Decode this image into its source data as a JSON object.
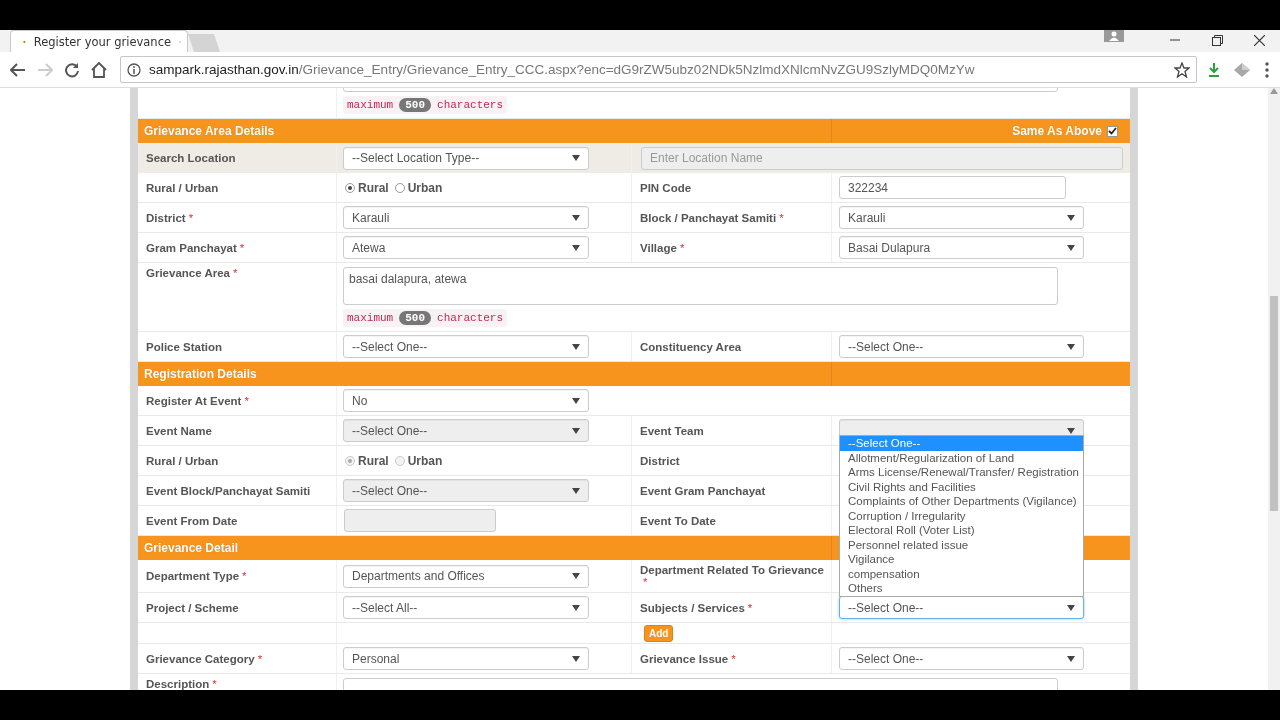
{
  "browser": {
    "tab_title": "Register your grievance",
    "url_domain": "sampark.rajasthan.gov.in",
    "url_path": "/Grievance_Entry/Grievance_Entry_CCC.aspx?enc=dG9rZW5ubz02NDk5NzlmdXNlcmNvZGU9SzlyMDQ0MzYw"
  },
  "form": {
    "lead_row": {
      "shaded": false,
      "cells": [
        {
          "kind": "empty"
        },
        {
          "kind": "textarea",
          "disabled": false,
          "counter": {
            "before": "maximum",
            "count": "500",
            "after": "characters"
          }
        }
      ]
    },
    "sections": [
      {
        "title": "Grievance Area Details",
        "same_as_above": {
          "label": "Same As Above",
          "checked": true
        },
        "rows": [
          {
            "shaded": true,
            "cells": [
              {
                "kind": "label",
                "text": "Search Location"
              },
              {
                "kind": "select",
                "value": "--Select Location Type--",
                "disabled": false,
                "focused": false
              },
              {
                "kind": "location-input",
                "placeholder": "Enter Location Name",
                "disabled": true
              }
            ]
          },
          {
            "shaded": false,
            "cells": [
              {
                "kind": "label",
                "text": "Rural / Urban"
              },
              {
                "kind": "radios",
                "disabled": false,
                "options": [
                  {
                    "text": "Rural",
                    "selected": true
                  },
                  {
                    "text": "Urban",
                    "selected": false
                  }
                ]
              },
              {
                "kind": "label",
                "text": "PIN Code"
              },
              {
                "kind": "input",
                "value": "322234",
                "disabled": false
              }
            ]
          },
          {
            "shaded": false,
            "cells": [
              {
                "kind": "label",
                "text": "District",
                "required": "*"
              },
              {
                "kind": "select",
                "value": "Karauli",
                "disabled": false,
                "focused": false
              },
              {
                "kind": "label",
                "text": "Block / Panchayat Samiti",
                "required": "*"
              },
              {
                "kind": "select",
                "value": "Karauli",
                "disabled": false,
                "focused": false
              }
            ]
          },
          {
            "shaded": false,
            "cells": [
              {
                "kind": "label",
                "text": "Gram Panchayat",
                "required": "*"
              },
              {
                "kind": "select",
                "value": "Atewa",
                "disabled": false,
                "focused": false
              },
              {
                "kind": "label",
                "text": "Village",
                "required": "*"
              },
              {
                "kind": "select",
                "value": "Basai Dulapura",
                "disabled": false,
                "focused": false
              }
            ]
          },
          {
            "shaded": false,
            "cells": [
              {
                "kind": "label",
                "text": "Grievance Area",
                "required": "*"
              },
              {
                "kind": "textarea",
                "value": "basai dalapura, atewa",
                "disabled": false,
                "counter": {
                  "before": "maximum",
                  "count": "500",
                  "after": "characters"
                }
              }
            ]
          },
          {
            "shaded": false,
            "cells": [
              {
                "kind": "label",
                "text": "Police Station"
              },
              {
                "kind": "select",
                "value": "--Select One--",
                "disabled": false,
                "focused": false
              },
              {
                "kind": "label",
                "text": "Constituency Area"
              },
              {
                "kind": "select",
                "value": "--Select One--",
                "disabled": false,
                "focused": false
              }
            ]
          }
        ]
      },
      {
        "title": "Registration Details",
        "rows": [
          {
            "shaded": false,
            "cells": [
              {
                "kind": "label",
                "text": "Register At Event",
                "required": "*"
              },
              {
                "kind": "select",
                "value": "No",
                "disabled": false,
                "focused": false
              }
            ]
          },
          {
            "shaded": false,
            "cells": [
              {
                "kind": "label",
                "text": "Event Name"
              },
              {
                "kind": "select",
                "value": "--Select One--",
                "disabled": true,
                "focused": false
              },
              {
                "kind": "label",
                "text": "Event Team"
              },
              {
                "kind": "select",
                "disabled": true,
                "focused": false
              }
            ]
          },
          {
            "shaded": false,
            "cells": [
              {
                "kind": "label",
                "text": "Rural / Urban"
              },
              {
                "kind": "radios",
                "disabled": true,
                "options": [
                  {
                    "text": "Rural",
                    "selected": true
                  },
                  {
                    "text": "Urban",
                    "selected": false
                  }
                ]
              },
              {
                "kind": "label",
                "text": "District"
              },
              {
                "kind": "empty"
              }
            ]
          },
          {
            "shaded": false,
            "cells": [
              {
                "kind": "label",
                "text": "Event Block/Panchayat Samiti"
              },
              {
                "kind": "select",
                "value": "--Select One--",
                "disabled": true,
                "focused": false
              },
              {
                "kind": "label",
                "text": "Event Gram Panchayat"
              },
              {
                "kind": "empty"
              }
            ]
          },
          {
            "shaded": false,
            "cells": [
              {
                "kind": "label",
                "text": "Event From Date"
              },
              {
                "kind": "date",
                "disabled": true
              },
              {
                "kind": "label",
                "text": "Event To Date"
              },
              {
                "kind": "empty"
              }
            ]
          }
        ]
      },
      {
        "title": "Grievance Detail",
        "rows": [
          {
            "shaded": false,
            "cells": [
              {
                "kind": "label",
                "text": "Department Type",
                "required": "*"
              },
              {
                "kind": "select",
                "value": "Departments and Offices",
                "disabled": false,
                "focused": false
              },
              {
                "kind": "label",
                "text": "Department Related To Grievance",
                "required": "*"
              },
              {
                "kind": "empty"
              }
            ]
          },
          {
            "shaded": false,
            "cells": [
              {
                "kind": "label",
                "text": "Project / Scheme"
              },
              {
                "kind": "select",
                "value": "--Select All--",
                "disabled": false,
                "focused": false
              },
              {
                "kind": "label",
                "text": "Subjects / Services",
                "required": "*"
              },
              {
                "kind": "select",
                "value": "--Select One--",
                "disabled": false,
                "focused": true,
                "options": [
                  {
                    "text": "--Select One--",
                    "selected": true
                  },
                  {
                    "text": "Allotment/Regularization of Land",
                    "selected": false
                  },
                  {
                    "text": "Arms License/Renewal/Transfer/ Registration",
                    "selected": false
                  },
                  {
                    "text": "Civil Rights and Facilities",
                    "selected": false
                  },
                  {
                    "text": "Complaints of Other Departments (Vigilance)",
                    "selected": false
                  },
                  {
                    "text": "Corruption / Irregularity",
                    "selected": false
                  },
                  {
                    "text": "Electoral Roll (Voter List)",
                    "selected": false
                  },
                  {
                    "text": "Personnel related issue",
                    "selected": false
                  },
                  {
                    "text": "Vigilance",
                    "selected": false
                  },
                  {
                    "text": "compensation",
                    "selected": false
                  },
                  {
                    "text": "Others",
                    "selected": false
                  }
                ]
              }
            ]
          },
          {
            "shaded": false,
            "cells": [
              {
                "kind": "empty"
              },
              {
                "kind": "empty"
              },
              {
                "kind": "add-button",
                "text": "Add"
              },
              {
                "kind": "empty"
              }
            ]
          },
          {
            "shaded": false,
            "cells": [
              {
                "kind": "label",
                "text": "Grievance Category",
                "required": "*"
              },
              {
                "kind": "select",
                "value": "Personal",
                "disabled": false,
                "focused": false
              },
              {
                "kind": "label",
                "text": "Grievance Issue",
                "required": "*"
              },
              {
                "kind": "select",
                "value": "--Select One--",
                "disabled": false,
                "focused": false
              }
            ]
          },
          {
            "shaded": false,
            "cells": [
              {
                "kind": "label",
                "text": "Description",
                "required": "*"
              },
              {
                "kind": "textarea",
                "disabled": false
              }
            ]
          }
        ]
      }
    ]
  }
}
